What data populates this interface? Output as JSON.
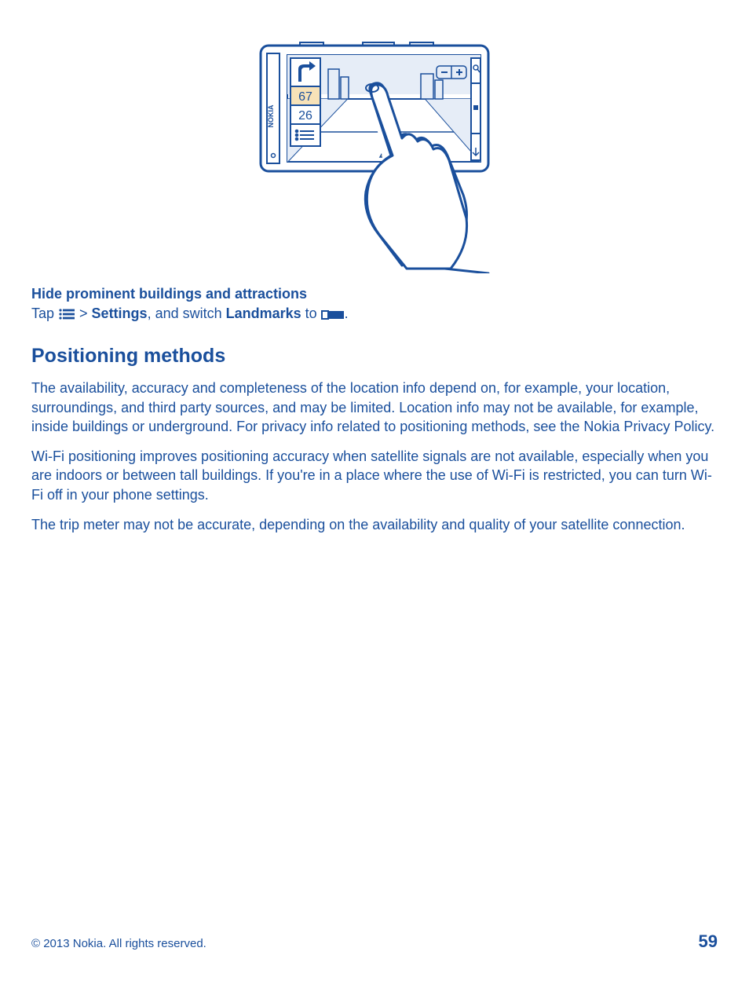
{
  "illustration": {
    "brand": "NOKIA",
    "value_top": "67",
    "value_bottom": "26"
  },
  "subheading": "Hide prominent buildings and attractions",
  "instruction": {
    "tap": "Tap ",
    "chevron": " > ",
    "settings": "Settings",
    "middle": ", and switch ",
    "landmarks": "Landmarks",
    "to": " to ",
    "period": "."
  },
  "section_heading": "Positioning methods",
  "para1": "The availability, accuracy and completeness of the location info depend on, for example, your location, surroundings, and third party sources, and may be limited. Location info may not be available, for example, inside buildings or underground. For privacy info related to positioning methods, see the Nokia Privacy Policy.",
  "para2": "Wi-Fi positioning improves positioning accuracy when satellite signals are not available, especially when you are indoors or between tall buildings. If you're in a place where the use of Wi-Fi is restricted, you can turn Wi-Fi off in your phone settings.",
  "para3": "The trip meter may not be accurate, depending on the availability and quality of your satellite connection.",
  "footer": {
    "copyright": "© 2013 Nokia. All rights reserved.",
    "page": "59"
  }
}
